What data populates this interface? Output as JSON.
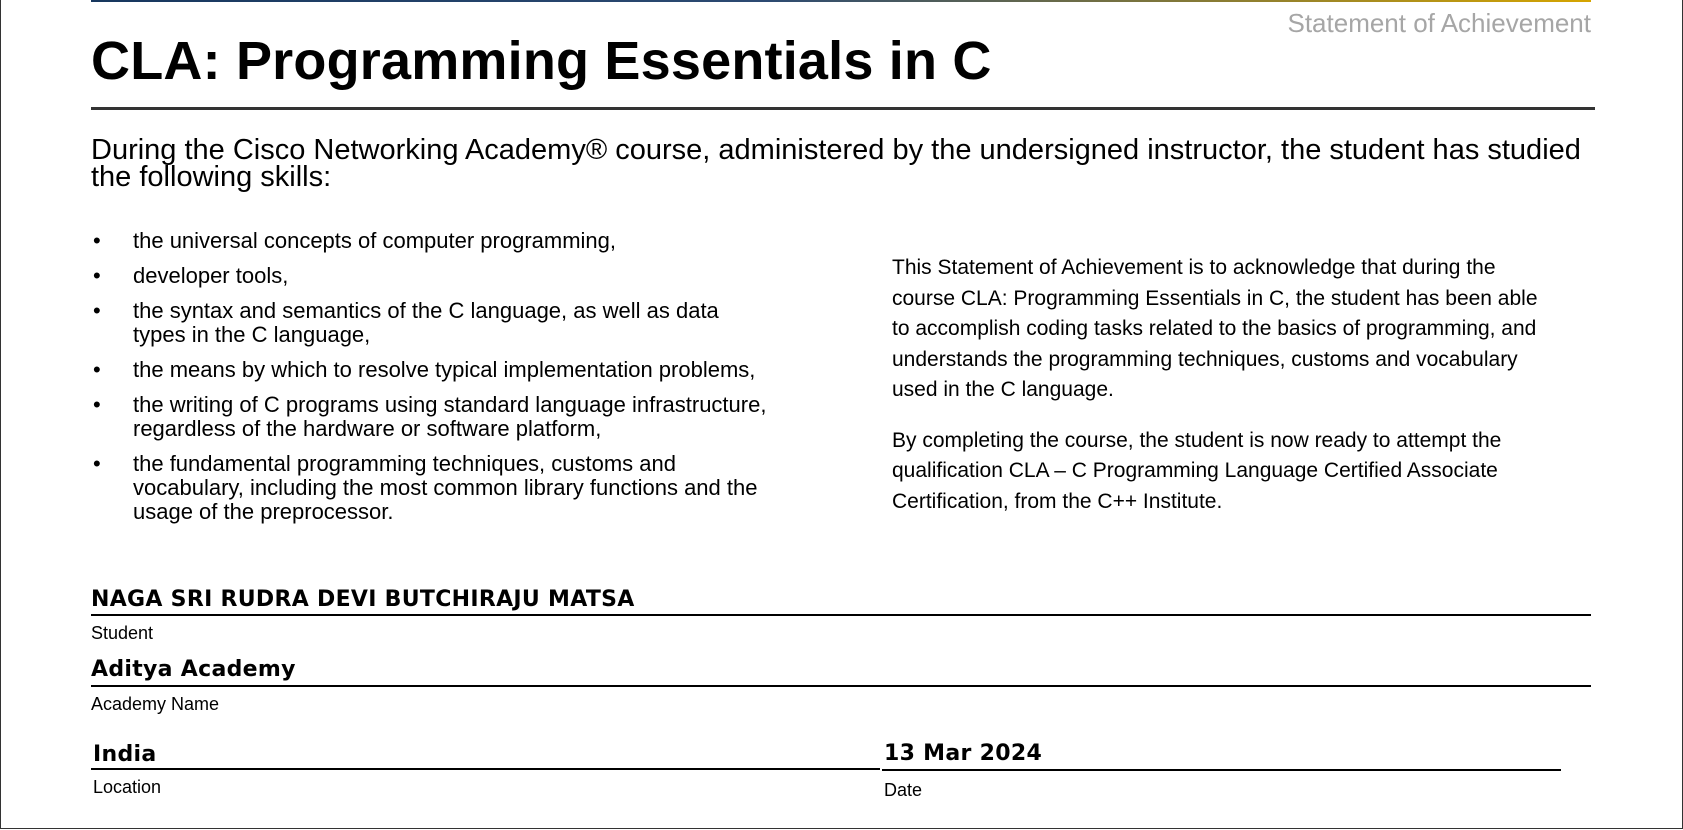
{
  "header": {
    "statement_label": "Statement of Achievement",
    "title": "CLA: Programming Essentials in C"
  },
  "intro": "During the Cisco Networking Academy® course, administered by the undersigned instructor, the student has studied the following skills:",
  "skills": [
    "the universal concepts of computer programming,",
    "developer tools,",
    "the syntax and semantics of the C language, as well as data types in the C language,",
    "the means by which to resolve typical implementation problems,",
    "the writing of C programs using standard language infrastructure, regardless of the hardware or software platform,",
    "the fundamental programming techniques, customs and vocabulary, including the most common library functions and the usage of the preprocessor."
  ],
  "statement": {
    "paragraph1": "This Statement of Achievement is to acknowledge that during the course CLA: Programming Essentials in C, the student has been able to accomplish coding tasks related to the basics of programming, and understands the programming techniques, customs and vocabulary used in the C language.",
    "paragraph2": "By completing the course, the student is now ready to attempt the qualification CLA – C Programming Language Certified Associate Certification, from the C++ Institute."
  },
  "fields": {
    "student": {
      "value": "NAGA SRI RUDRA DEVI BUTCHIRAJU MATSA",
      "label": "Student"
    },
    "academy": {
      "value": "Aditya Academy",
      "label": "Academy Name"
    },
    "location": {
      "value": "India",
      "label": "Location"
    },
    "date": {
      "value": "13 Mar 2024",
      "label": "Date"
    }
  },
  "colors": {
    "title_rule": "#333333",
    "statement_label": "#a6a6a6",
    "top_rule_start": "#17375e",
    "top_rule_end": "#d6a500"
  }
}
